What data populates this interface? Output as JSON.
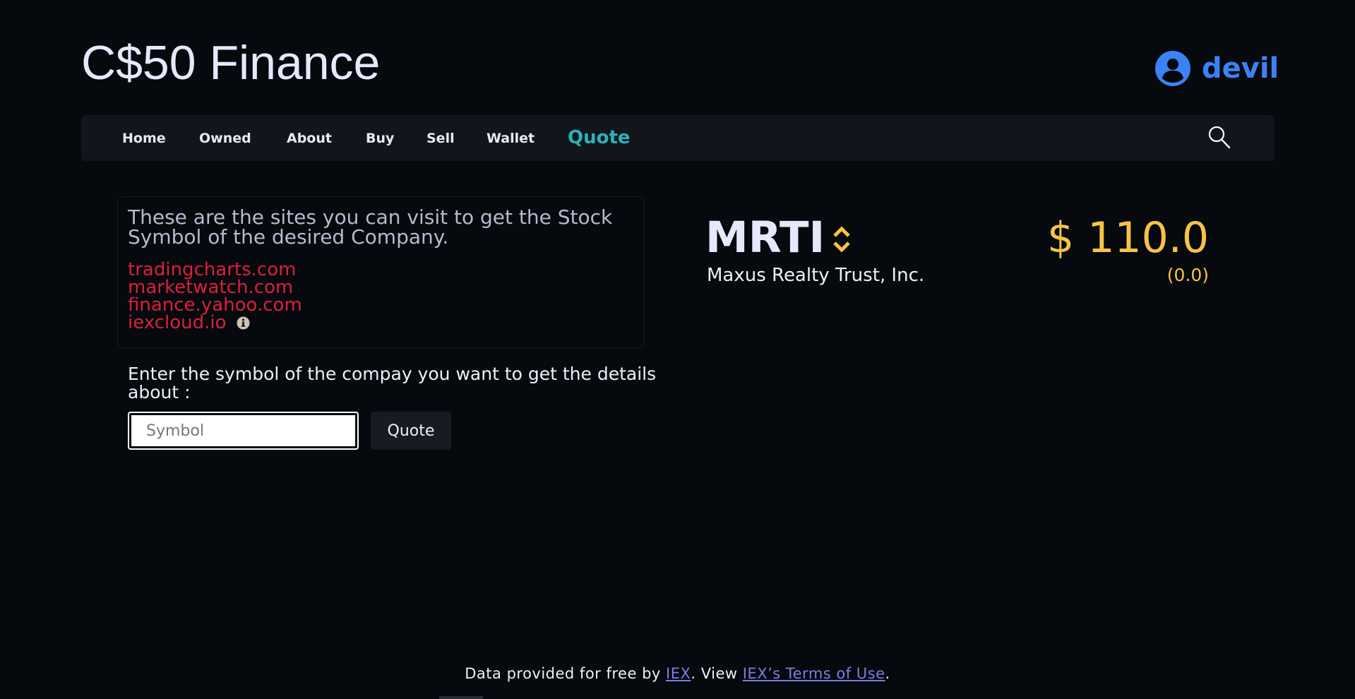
{
  "brand": {
    "title": "C$50 Finance"
  },
  "user": {
    "name": "devil",
    "icon": "user-circle-icon",
    "color": "#3b82f6"
  },
  "nav": {
    "items": [
      {
        "label": "Home"
      },
      {
        "label": "Owned"
      },
      {
        "label": "About"
      },
      {
        "label": "Buy"
      },
      {
        "label": "Sell"
      },
      {
        "label": "Wallet"
      },
      {
        "label": "Quote",
        "active": true
      }
    ],
    "search_icon": "search-icon",
    "active_color": "#2bb3b8"
  },
  "info": {
    "text": "These are the sites you can visit to get the Stock Symbol of the desired Company.",
    "sites": [
      "tradingcharts.com",
      "marketwatch.com",
      "finance.yahoo.com",
      "iexcloud.io"
    ],
    "link_color": "#dc1f3c",
    "info_icon": "info-icon"
  },
  "form": {
    "prompt": "Enter the symbol of the compay you want to get the details about :",
    "symbol_placeholder": "Symbol",
    "symbol_value": "",
    "button_label": "Quote"
  },
  "quote": {
    "symbol": "MRTI",
    "company": "Maxus Realty Trust, Inc.",
    "price": "$ 110.0",
    "change": "(0.0)",
    "price_color": "#f6c344",
    "sort_icon": "sort-icon"
  },
  "footer": {
    "prefix": "Data provided for free by ",
    "iex_link": "IEX",
    "middle": ". View ",
    "terms_link": "IEX’s Terms of Use",
    "suffix": "."
  }
}
